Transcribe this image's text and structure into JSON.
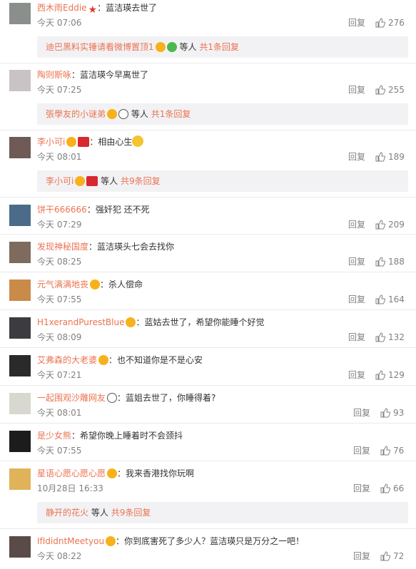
{
  "colors": {
    "username": "#eb7350",
    "text": "#333333",
    "meta": "#808080",
    "subbox_bg": "#f2f2f5"
  },
  "reply_label": "回复",
  "comments": [
    {
      "username": "西木雨Eddie",
      "text": "：蓝洁瑛去世了",
      "time": "今天 07:06",
      "likes": "276",
      "sub": {
        "username": "迪巴黑料实锤请看微博置顶1",
        "suffix": "等人",
        "count": "共1条回复"
      }
    },
    {
      "username": "陶则斯咏",
      "text": "：蓝洁瑛今早离世了",
      "time": "今天 07:25",
      "likes": "255",
      "sub": {
        "username": "張學友的小谜弟",
        "suffix": "等人",
        "count": "共1条回复"
      }
    },
    {
      "username": "李小可i",
      "text": "：相由心生",
      "time": "今天 08:01",
      "likes": "189",
      "sub": {
        "username": "李小可i",
        "suffix": "等人",
        "count": "共9条回复"
      }
    },
    {
      "username": "饼干666666",
      "text": "：强奸犯 还不死",
      "time": "今天 07:29",
      "likes": "209"
    },
    {
      "username": "发现神秘国度",
      "text": "：蓝洁瑛头七会去找你",
      "time": "今天 08:25",
      "likes": "188"
    },
    {
      "username": "元气满满地丧",
      "text": "：杀人偿命",
      "time": "今天 07:55",
      "likes": "164"
    },
    {
      "username": "H1xerandPurestBlue",
      "text": "：蓝姑去世了，希望你能睡个好觉",
      "time": "今天 08:09",
      "likes": "132"
    },
    {
      "username": "艾弗森的大老婆",
      "text": "：也不知道你是不是心安",
      "time": "今天 07:21",
      "likes": "129"
    },
    {
      "username": "一起围观沙雕网友",
      "text": "：蓝姐去世了，你睡得着?",
      "time": "今天 08:01",
      "likes": "93"
    },
    {
      "username": "是少女熊",
      "text": "：希望你晚上睡着时不会颈抖",
      "time": "今天 07:55",
      "likes": "76"
    },
    {
      "username": "星语心愿心愿心愿",
      "text": "：我来香港找你玩啊",
      "time": "10月28日 16:33",
      "likes": "66",
      "sub": {
        "username": "静开的花火",
        "suffix": "等人",
        "count": "共9条回复"
      }
    },
    {
      "username": "IfIdidntMeetyou",
      "text": "：你到底害死了多少人？蓝洁瑛只是万分之一吧！",
      "time": "今天 08:22",
      "likes": "72"
    }
  ]
}
